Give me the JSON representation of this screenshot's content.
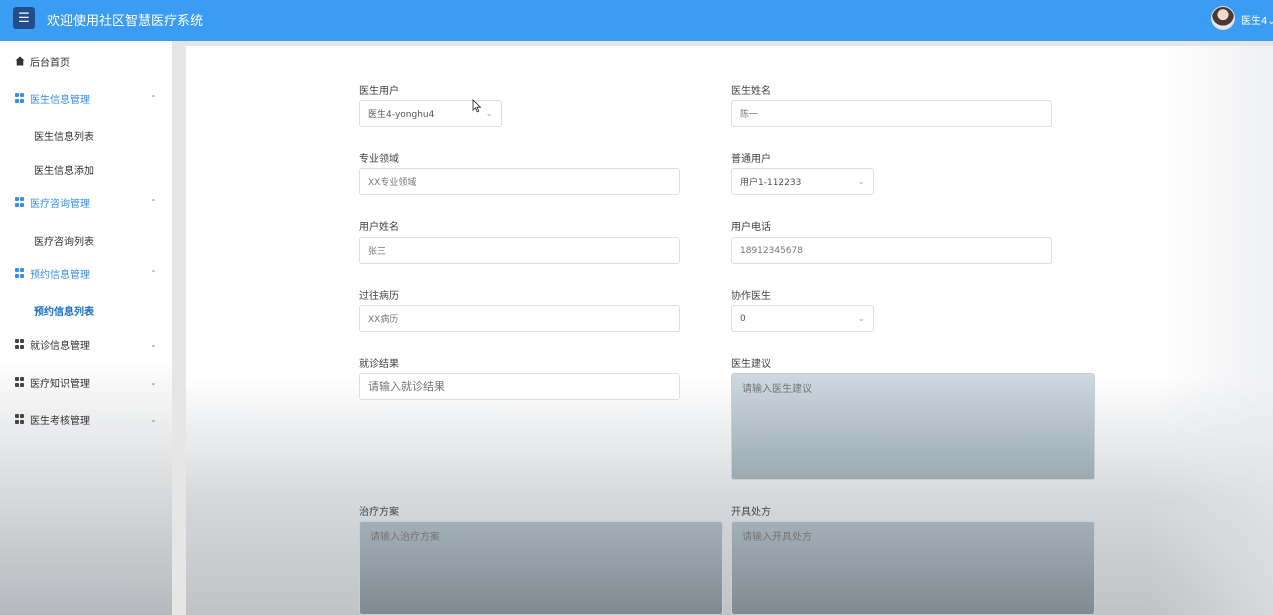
{
  "header": {
    "title": "欢迎使用社区智慧医疗系统",
    "menu_icon": "☰",
    "user_name": "医生4",
    "user_caret": "⌄",
    "accent": "#3a9cf2"
  },
  "sidebar": {
    "home": "后台首页",
    "groups": [
      {
        "label": "医生信息管理",
        "caret": "⌃",
        "items": [
          "医生信息列表",
          "医生信息添加"
        ]
      },
      {
        "label": "医疗咨询管理",
        "caret": "⌃",
        "items": [
          "医疗咨询列表"
        ]
      },
      {
        "label": "预约信息管理",
        "caret": "⌃",
        "items": [
          "预约信息列表"
        ]
      },
      {
        "label": "就诊信息管理",
        "caret": "⌄",
        "items": []
      },
      {
        "label": "医疗知识管理",
        "caret": "⌄",
        "items": []
      },
      {
        "label": "医生考核管理",
        "caret": "⌄",
        "items": []
      }
    ]
  },
  "form": {
    "doctor_user": {
      "label": "医生用户",
      "value": "医生4-yonghu4"
    },
    "doctor_name": {
      "label": "医生姓名",
      "value": "陈一"
    },
    "specialty": {
      "label": "专业领域",
      "value": "XX专业领域"
    },
    "normal_user": {
      "label": "普通用户",
      "value": "用户1-112233"
    },
    "user_name": {
      "label": "用户姓名",
      "value": "张三"
    },
    "user_phone": {
      "label": "用户电话",
      "value": "18912345678"
    },
    "history": {
      "label": "过往病历",
      "value": "XX病历"
    },
    "assist_doctor": {
      "label": "协作医生",
      "value": "0"
    },
    "result": {
      "label": "就诊结果",
      "placeholder": "请输入就诊结果"
    },
    "advice": {
      "label": "医生建议",
      "placeholder": "请输入医生建议"
    },
    "plan": {
      "label": "治疗方案",
      "placeholder": "请输入治疗方案"
    },
    "prescription": {
      "label": "开具处方",
      "placeholder": "请输入开具处方"
    }
  }
}
